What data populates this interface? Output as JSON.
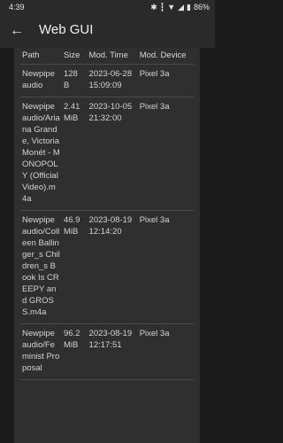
{
  "status_bar": {
    "time": "4:39",
    "battery": "86%",
    "icons": [
      "bluetooth-icon",
      "vibrate-icon",
      "wifi-icon",
      "signal-icon",
      "battery-icon"
    ]
  },
  "app_bar": {
    "title": "Web GUI",
    "back_icon": "arrow-back-icon"
  },
  "table": {
    "headers": [
      "Path",
      "Size",
      "Mod. Time",
      "Mod. Device"
    ],
    "rows": [
      {
        "path": "Newpipe audio",
        "size": "128 B",
        "time": "2023-06-28 15:09:09",
        "device": "Pixel 3a"
      },
      {
        "path": "Newpipe audio/Ariana Grande, Victoria Monét - MONOPOLY (Official Video).m4a",
        "size": "2.41 MiB",
        "time": "2023-10-05 21:32:00",
        "device": "Pixel 3a"
      },
      {
        "path": "Newpipe audio/Colleen Ballinger_s Children_s Book Is CREEPY and GROSS.m4a",
        "size": "46.9 MiB",
        "time": "2023-08-19 12:14:20",
        "device": "Pixel 3a"
      },
      {
        "path": "Newpipe audio/Feminist Proposal",
        "size": "96.2 MiB",
        "time": "2023-08-19 12:17:51",
        "device": "Pixel 3a"
      }
    ]
  },
  "colors": {
    "background": "#1b1b1b",
    "panel": "#2f2f2f",
    "bar": "#2a2a2a",
    "divider": "#4a4a4a"
  }
}
